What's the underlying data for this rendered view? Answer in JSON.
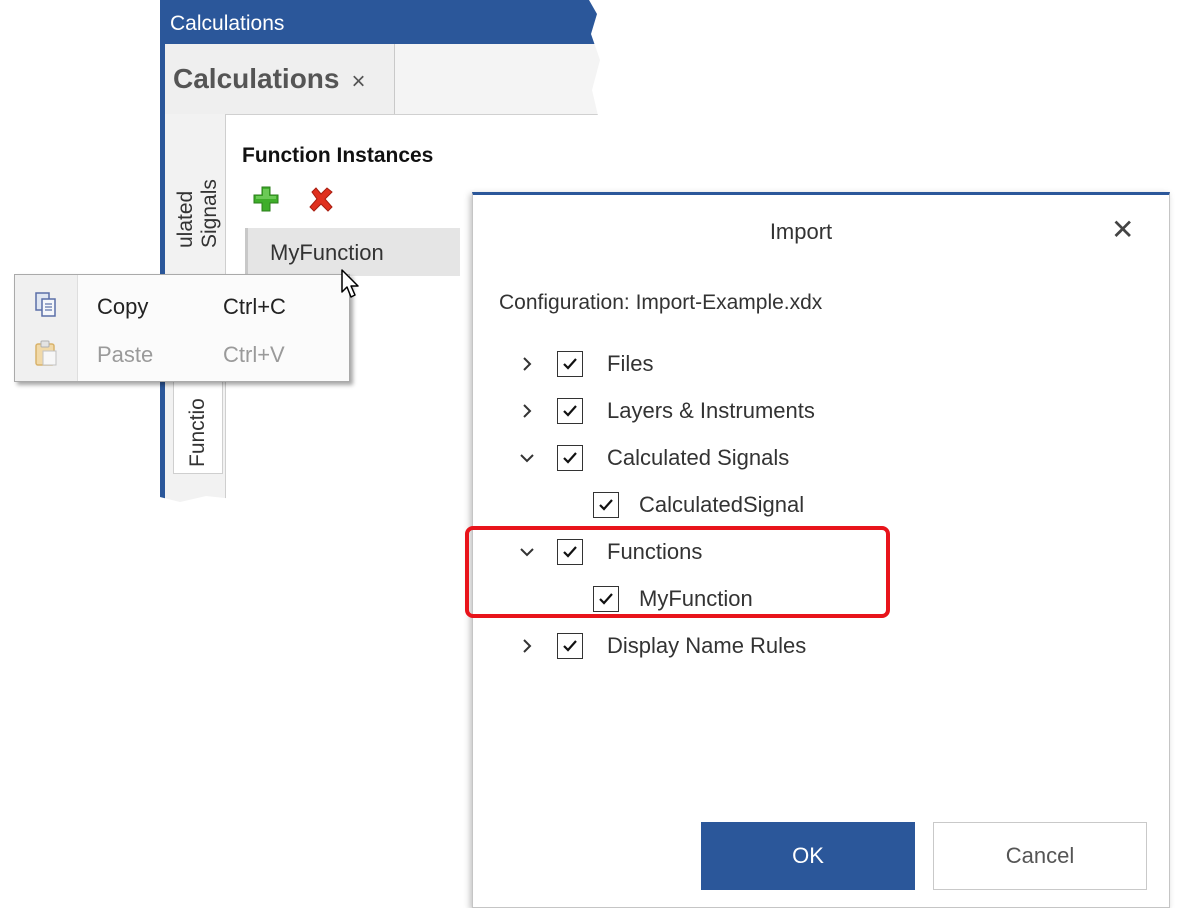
{
  "calculations_window": {
    "title": "Calculations",
    "tab_label": "Calculations",
    "tab_close_glyph": "×",
    "vertical_tabs": [
      "ulated Signals",
      "Functio"
    ],
    "section_heading": "Function Instances",
    "toolbar_icons": [
      "add-icon",
      "delete-icon"
    ],
    "function_list": [
      "MyFunction"
    ]
  },
  "context_menu": {
    "items": [
      {
        "label": "Copy",
        "shortcut": "Ctrl+C",
        "icon": "copy-icon",
        "enabled": true
      },
      {
        "label": "Paste",
        "shortcut": "Ctrl+V",
        "icon": "paste-icon",
        "enabled": false
      }
    ]
  },
  "import_dialog": {
    "title": "Import",
    "close_glyph": "✕",
    "configuration_text": "Configuration: Import-Example.xdx",
    "tree": [
      {
        "label": "Files",
        "level": 0,
        "expanded": false,
        "checked": true
      },
      {
        "label": "Layers & Instruments",
        "level": 0,
        "expanded": false,
        "checked": true
      },
      {
        "label": "Calculated Signals",
        "level": 0,
        "expanded": true,
        "checked": true
      },
      {
        "label": "CalculatedSignal",
        "level": 1,
        "checked": true
      },
      {
        "label": "Functions",
        "level": 0,
        "expanded": true,
        "checked": true
      },
      {
        "label": "MyFunction",
        "level": 1,
        "checked": true
      },
      {
        "label": "Display Name Rules",
        "level": 0,
        "expanded": false,
        "checked": true
      }
    ],
    "ok_label": "OK",
    "cancel_label": "Cancel"
  },
  "colors": {
    "accent_blue": "#2b579a",
    "highlight_red": "#e8141b",
    "add_green": "#3fae2a",
    "delete_red": "#e0301e"
  }
}
